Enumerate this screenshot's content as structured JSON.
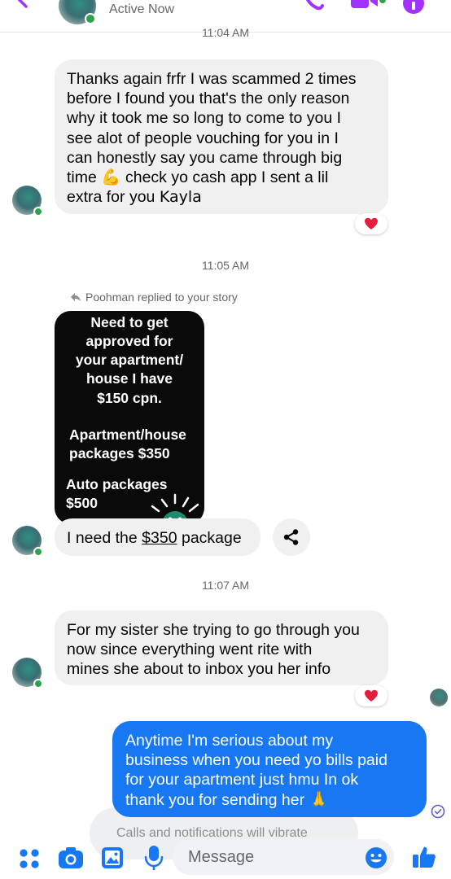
{
  "header": {
    "status": "Active Now",
    "icons": [
      "back-arrow-icon",
      "phone-icon",
      "video-camera-icon",
      "info-icon"
    ]
  },
  "thread": {
    "timestamps": [
      "11:04 AM",
      "11:05 AM",
      "11:07 AM"
    ],
    "messages": [
      {
        "direction": "incoming",
        "text": "Thanks again frfr I was scammed 2 times\nbefore I found you  that's the only reason\nwhy it took me so long to come to you I\nsee alot of people vouching for you in I\ncan honestly   say you came through big\ntime",
        "emoji": "💪",
        "text_after_emoji": "check yo cash app I sent a lil",
        "text_last_line": "extra for you",
        "signature": "Kayla",
        "reaction": "heart"
      },
      {
        "direction": "incoming",
        "reply_note": "Poohman replied to your story",
        "text_prefix": "I need the ",
        "link": "$350",
        "text_suffix": " package"
      },
      {
        "direction": "incoming",
        "text": "For my sister she trying to go through you\nnow  since everything went rite with\nmines she about to inbox you her info",
        "reaction": "heart"
      },
      {
        "direction": "outgoing",
        "text": "Anytime I'm serious about my\nbusiness when you need yo bills paid\nfor your apartment just hmu In ok\nthank you for sending her",
        "emoji": "🙏"
      }
    ]
  },
  "story": {
    "lines": [
      "Need to get",
      "approved for",
      "your apartment/",
      "house I have",
      "$150 cpn.",
      "Apartment/house",
      "packages $350",
      "Auto packages",
      "$500"
    ]
  },
  "toast": {
    "text": "Calls and notifications will vibrate"
  },
  "composer": {
    "placeholder": "Message",
    "icons": [
      "menu-dots-icon",
      "camera-icon",
      "gallery-icon",
      "microphone-icon",
      "emoji-icon",
      "like-icon"
    ]
  },
  "colors": {
    "accent": "#1877f2",
    "incoming_bubble": "#f0f0f0",
    "online": "#31a24c",
    "header_purple": "#a033ff",
    "heart": "#e41e3f"
  }
}
